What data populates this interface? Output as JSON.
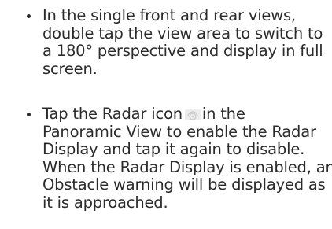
{
  "instructions": {
    "items": [
      {
        "lines": [
          "In the single front and rear views,",
          "double tap the view area to switch to",
          "a 180° perspective and display in full",
          "screen."
        ]
      },
      {
        "line1_before_icon": "Tap the Radar icon",
        "line1_after_icon": "in the",
        "lines_rest": [
          "Panoramic View to enable the Radar",
          "Display and tap it again to disable.",
          "When the Radar Display is enabled, an",
          "Obstacle warning will be displayed as",
          "it is approached."
        ],
        "icon": "radar-icon"
      }
    ]
  }
}
